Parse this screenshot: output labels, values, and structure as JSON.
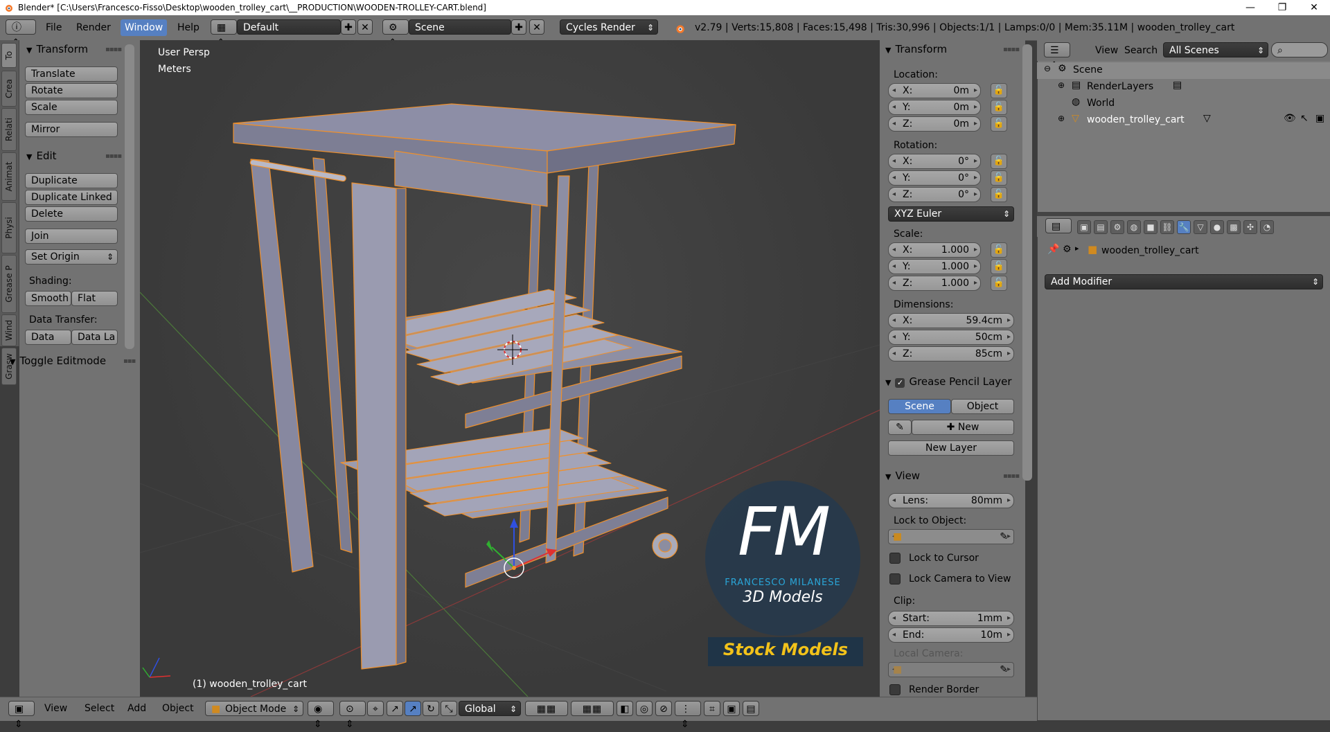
{
  "titlebar": {
    "title": "Blender* [C:\\Users\\Francesco-Fisso\\Desktop\\wooden_trolley_cart\\__PRODUCTION\\WOODEN-TROLLEY-CART.blend]",
    "minimize": "—",
    "maximize": "❐",
    "close": "✕"
  },
  "infobar": {
    "menus": [
      "File",
      "Render",
      "Window",
      "Help"
    ],
    "layout": "Default",
    "scene": "Scene",
    "engine": "Cycles Render",
    "stats": "v2.79 | Verts:15,808 | Faces:15,498 | Tris:30,996 | Objects:1/1 | Lamps:0/0 | Mem:35.11M | wooden_trolley_cart"
  },
  "tabs": [
    "To",
    "Crea",
    "Relati",
    "Animat",
    "Physi",
    "Grease P",
    "Wind",
    "Grasw"
  ],
  "toolshelf": {
    "transform_title": "Transform",
    "translate": "Translate",
    "rotate": "Rotate",
    "scale": "Scale",
    "mirror": "Mirror",
    "edit_title": "Edit",
    "duplicate": "Duplicate",
    "duplicate_linked": "Duplicate Linked",
    "delete": "Delete",
    "join": "Join",
    "set_origin": "Set Origin",
    "shading_label": "Shading:",
    "smooth": "Smooth",
    "flat": "Flat",
    "data_transfer_label": "Data Transfer:",
    "data": "Data",
    "data_la": "Data La",
    "toggle_editmode": "Toggle Editmode"
  },
  "viewport": {
    "view_name": "User Persp",
    "units": "Meters",
    "object_label": "(1) wooden_trolley_cart",
    "watermark_logo": "FM",
    "watermark_name": "FRANCESCO MILANESE",
    "watermark_sub": "3D Models",
    "watermark_stock": "Stock Models"
  },
  "npanel": {
    "transform_title": "Transform",
    "location_label": "Location:",
    "location": [
      {
        "k": "X:",
        "v": "0m"
      },
      {
        "k": "Y:",
        "v": "0m"
      },
      {
        "k": "Z:",
        "v": "0m"
      }
    ],
    "rotation_label": "Rotation:",
    "rotation": [
      {
        "k": "X:",
        "v": "0°"
      },
      {
        "k": "Y:",
        "v": "0°"
      },
      {
        "k": "Z:",
        "v": "0°"
      }
    ],
    "rotation_mode": "XYZ Euler",
    "scale_label": "Scale:",
    "scale": [
      {
        "k": "X:",
        "v": "1.000"
      },
      {
        "k": "Y:",
        "v": "1.000"
      },
      {
        "k": "Z:",
        "v": "1.000"
      }
    ],
    "dimensions_label": "Dimensions:",
    "dimensions": [
      {
        "k": "X:",
        "v": "59.4cm"
      },
      {
        "k": "Y:",
        "v": "50cm"
      },
      {
        "k": "Z:",
        "v": "85cm"
      }
    ],
    "grease_title": "Grease Pencil Layer",
    "scene_btn": "Scene",
    "object_btn": "Object",
    "new_btn": "New",
    "new_layer": "New Layer",
    "view_title": "View",
    "lens_k": "Lens:",
    "lens_v": "80mm",
    "lock_to_object": "Lock to Object:",
    "lock_to_cursor": "Lock to Cursor",
    "lock_camera": "Lock Camera to View",
    "clip_label": "Clip:",
    "clip_start_k": "Start:",
    "clip_start_v": "1mm",
    "clip_end_k": "End:",
    "clip_end_v": "10m",
    "local_camera": "Local Camera:",
    "render_border": "Render Border"
  },
  "outliner": {
    "view": "View",
    "search": "Search",
    "filter": "All Scenes",
    "items": [
      "Scene",
      "RenderLayers",
      "World",
      "wooden_trolley_cart"
    ]
  },
  "properties": {
    "object_name": "wooden_trolley_cart",
    "add_modifier": "Add Modifier"
  },
  "bottombar": {
    "menus": [
      "View",
      "Select",
      "Add",
      "Object"
    ],
    "mode": "Object Mode",
    "orientation": "Global"
  },
  "colors": {
    "accent": "#5680c2",
    "selection_outline": "#f0902a",
    "model": "#8d8ea2"
  }
}
